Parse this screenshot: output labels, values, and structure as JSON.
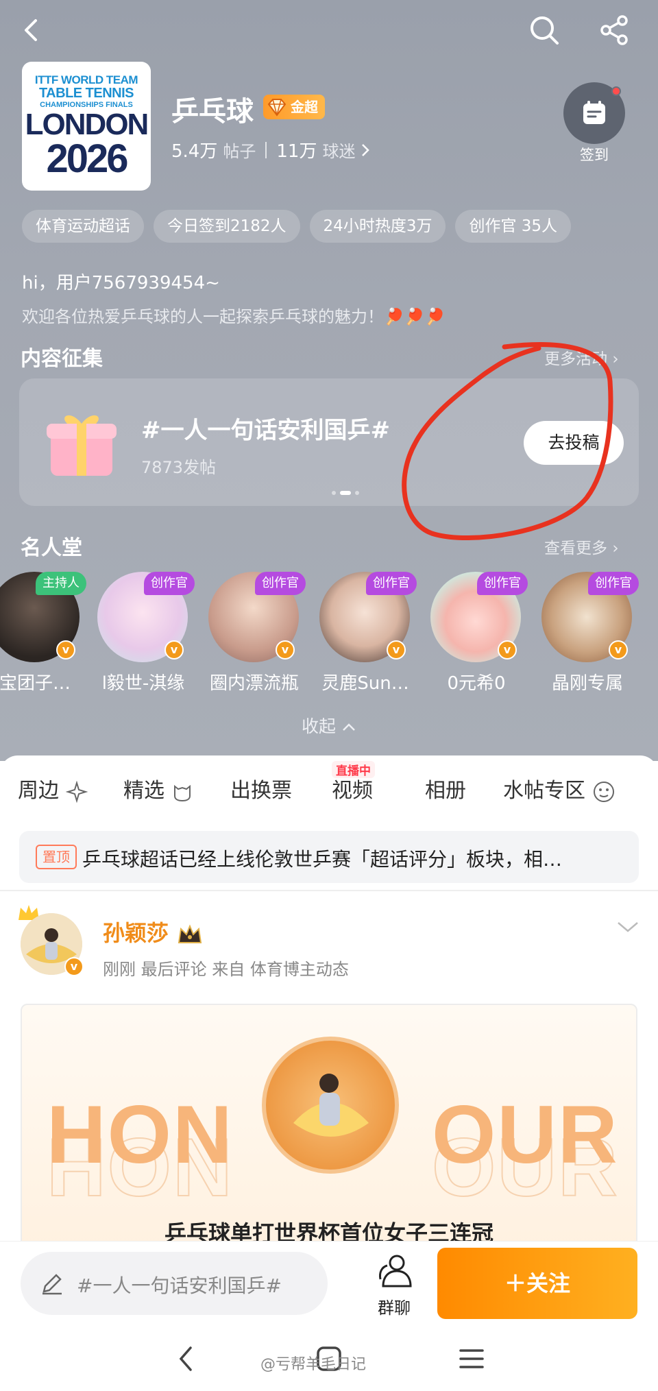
{
  "header": {
    "logo_lines": [
      "ITTF WORLD TEAM",
      "TABLE TENNIS",
      "CHAMPIONSHIPS FINALS",
      "LONDON",
      "2026"
    ],
    "title": "乒乓球",
    "level_badge": "金超",
    "posts_count": "5.4万",
    "posts_label": "帖子",
    "fans_count": "11万",
    "fans_label": "球迷",
    "checkin_label": "签到"
  },
  "chips": [
    "体育运动超话",
    "今日签到2182人",
    "24小时热度3万",
    "创作官 35人"
  ],
  "greeting": "hi，用户7567939454~",
  "welcome": "欢迎各位热爱乒乓球的人一起探索乒乓球的魅力！🏓🏓🏓",
  "collect": {
    "section_title": "内容征集",
    "more_label": "更多活动",
    "topic": "#一人一句话安利国乒#",
    "count": "7873发帖",
    "submit_label": "去投稿"
  },
  "fame": {
    "section_title": "名人堂",
    "more_label": "查看更多",
    "people": [
      {
        "name": "宝团子…",
        "role": "主持人"
      },
      {
        "name": "l毅世-淇缘",
        "role": "创作官"
      },
      {
        "name": "圈内漂流瓶",
        "role": "创作官"
      },
      {
        "name": "灵鹿Sun…",
        "role": "创作官"
      },
      {
        "name": "0元希0",
        "role": "创作官"
      },
      {
        "name": "晶刚专属",
        "role": "创作官"
      }
    ],
    "collapse_label": "收起"
  },
  "tabs": [
    "周边",
    "精选",
    "出换票",
    "视频",
    "相册",
    "水帖专区"
  ],
  "live_tag": "直播中",
  "pinned": {
    "tag": "置顶",
    "text": "乒乓球超话已经上线伦敦世乒赛「超话评分」板块，相…"
  },
  "post": {
    "author": "孙颖莎",
    "meta": "刚刚  最后评论   来自 体育博主动态",
    "honour_left": "HON",
    "honour_right": "OUR",
    "caption": "乒乓球单打世界杯首位女子三连冠"
  },
  "bottom": {
    "compose_placeholder": "#一人一句话安利国乒#",
    "group_label": "群聊",
    "follow_label": "＋关注"
  },
  "watermark": "@亏帮羊毛日记",
  "colors": {
    "accent_orange": "#ff8a00",
    "header_bg": "#a3a8b2",
    "creator_purple": "#b54be0",
    "host_green": "#3cc27a",
    "author_orange": "#f08c1a",
    "annotation_red": "#e8321f"
  }
}
